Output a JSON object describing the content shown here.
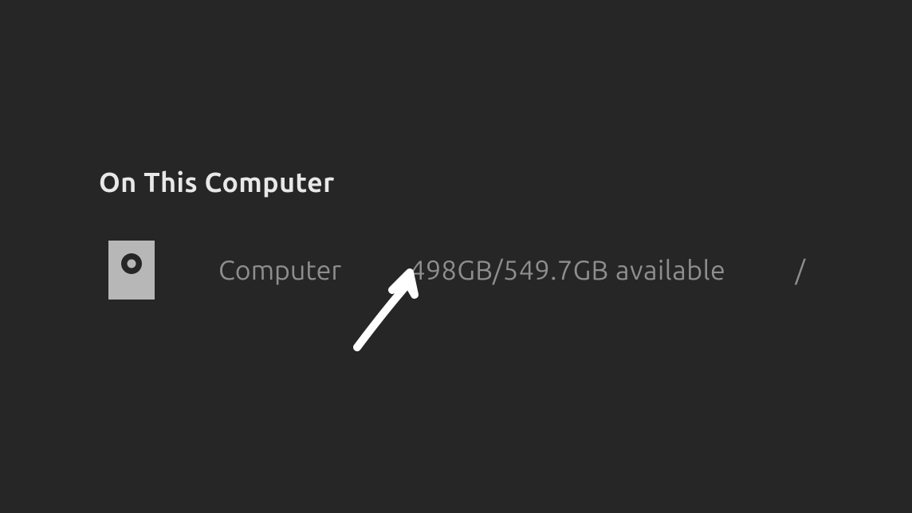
{
  "section": {
    "title": "On This Computer"
  },
  "disk": {
    "name": "Computer",
    "storage": "498GB/549.7GB available",
    "mount": "/"
  }
}
